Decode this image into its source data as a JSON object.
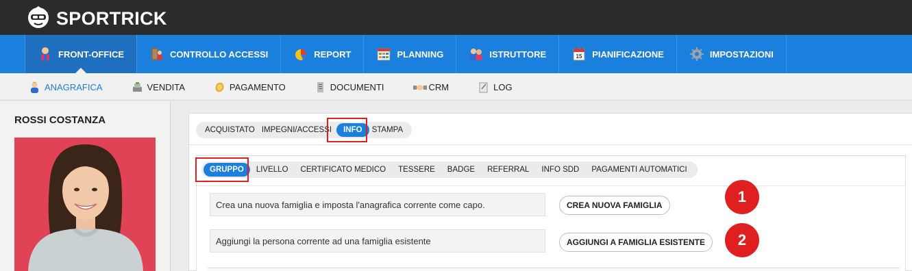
{
  "brand": {
    "name": "SPORTRICK"
  },
  "main_nav": [
    {
      "label": "FRONT-OFFICE",
      "icon": "person-icon",
      "active": true
    },
    {
      "label": "CONTROLLO ACCESSI",
      "icon": "access-control-icon",
      "active": false
    },
    {
      "label": "REPORT",
      "icon": "pie-chart-icon",
      "active": false
    },
    {
      "label": "PLANNING",
      "icon": "calendar-grid-icon",
      "active": false
    },
    {
      "label": "ISTRUTTORE",
      "icon": "instructors-icon",
      "active": false
    },
    {
      "label": "PIANIFICAZIONE",
      "icon": "calendar-icon",
      "active": false
    },
    {
      "label": "IMPOSTAZIONI",
      "icon": "gear-icon",
      "active": false
    }
  ],
  "sub_nav": [
    {
      "label": "ANAGRAFICA",
      "icon": "user-icon",
      "active": true
    },
    {
      "label": "VENDITA",
      "icon": "cash-register-icon",
      "active": false
    },
    {
      "label": "PAGAMENTO",
      "icon": "coin-icon",
      "active": false
    },
    {
      "label": "DOCUMENTI",
      "icon": "document-icon",
      "active": false
    },
    {
      "label": "CRM",
      "icon": "handshake-icon",
      "active": false
    },
    {
      "label": "LOG",
      "icon": "log-icon",
      "active": false
    }
  ],
  "person": {
    "name": "ROSSI COSTANZA"
  },
  "tabs_primary": [
    {
      "label": "ACQUISTATO",
      "active": false
    },
    {
      "label": "IMPEGNI/ACCESSI",
      "active": false
    },
    {
      "label": "INFO",
      "active": true
    },
    {
      "label": "STAMPA",
      "active": false
    }
  ],
  "tabs_secondary": [
    {
      "label": "GRUPPO",
      "active": true
    },
    {
      "label": "LIVELLO",
      "active": false
    },
    {
      "label": "CERTIFICATO MEDICO",
      "active": false
    },
    {
      "label": "TESSERE",
      "active": false
    },
    {
      "label": "BADGE",
      "active": false
    },
    {
      "label": "REFERRAL",
      "active": false
    },
    {
      "label": "INFO SDD",
      "active": false
    },
    {
      "label": "PAGAMENTI AUTOMATICI",
      "active": false
    }
  ],
  "family_actions": [
    {
      "description": "Crea una nuova famiglia e imposta l'anagrafica corrente come capo.",
      "button": "CREA NUOVA FAMIGLIA",
      "step": "1"
    },
    {
      "description": "Aggiungi la persona corrente ad una famiglia esistente",
      "button": "AGGIUNGI A FAMIGLIA ESISTENTE",
      "step": "2"
    }
  ],
  "colors": {
    "primary": "#1a7fdd",
    "highlight": "#e02020",
    "topbar": "#2b2b2b",
    "photo_bg": "#e04256"
  }
}
